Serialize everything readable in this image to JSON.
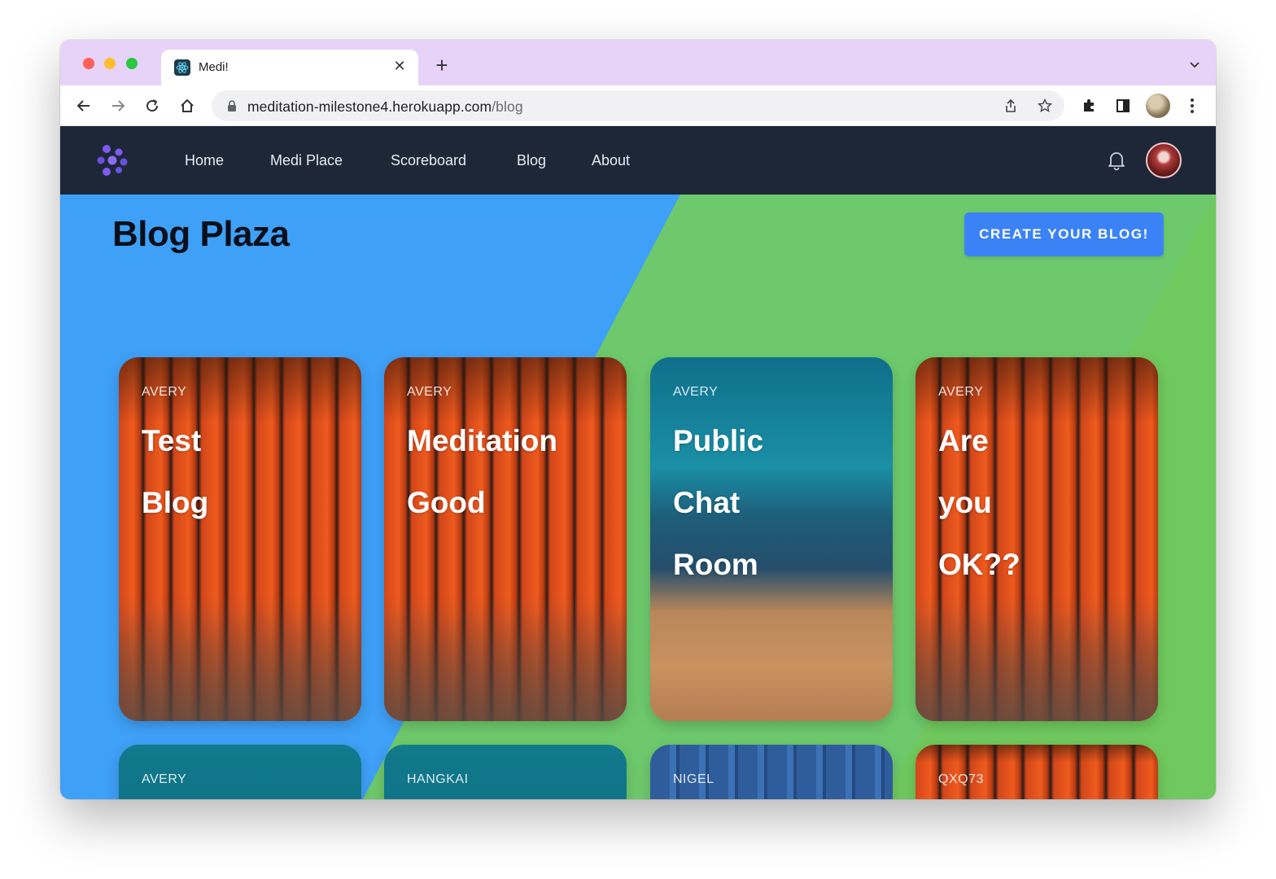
{
  "browser": {
    "tab_title": "Medi!",
    "url_host": "meditation-milestone4.herokuapp.com",
    "url_path": "/blog"
  },
  "navbar": {
    "links": [
      "Home",
      "Medi Place",
      "Scoreboard",
      "Blog",
      "About"
    ]
  },
  "header": {
    "title": "Blog Plaza",
    "create_button": "CREATE YOUR BLOG!"
  },
  "cards": [
    {
      "author": "AVERY",
      "title_words": [
        "Test",
        "Blog"
      ],
      "background": "torii-gates"
    },
    {
      "author": "AVERY",
      "title_words": [
        "Meditation",
        "Good"
      ],
      "background": "torii-gates"
    },
    {
      "author": "AVERY",
      "title_words": [
        "Public",
        "Chat",
        "Room"
      ],
      "background": "desert-dune"
    },
    {
      "author": "AVERY",
      "title_words": [
        "Are",
        "you",
        "OK??"
      ],
      "background": "torii-gates"
    },
    {
      "author": "AVERY",
      "title_words": [],
      "background": "teal"
    },
    {
      "author": "HANGKAI",
      "title_words": [],
      "background": "teal"
    },
    {
      "author": "NIGEL",
      "title_words": [],
      "background": "shipping-container"
    },
    {
      "author": "QXQ73",
      "title_words": [],
      "background": "torii-gates"
    }
  ],
  "colors": {
    "navbar_bg": "#1e2738",
    "hero_blue": "#3fa0f7",
    "hero_green": "#6ec96c",
    "button_blue": "#3b82f6",
    "logo_purple": "#7b5cf0"
  }
}
